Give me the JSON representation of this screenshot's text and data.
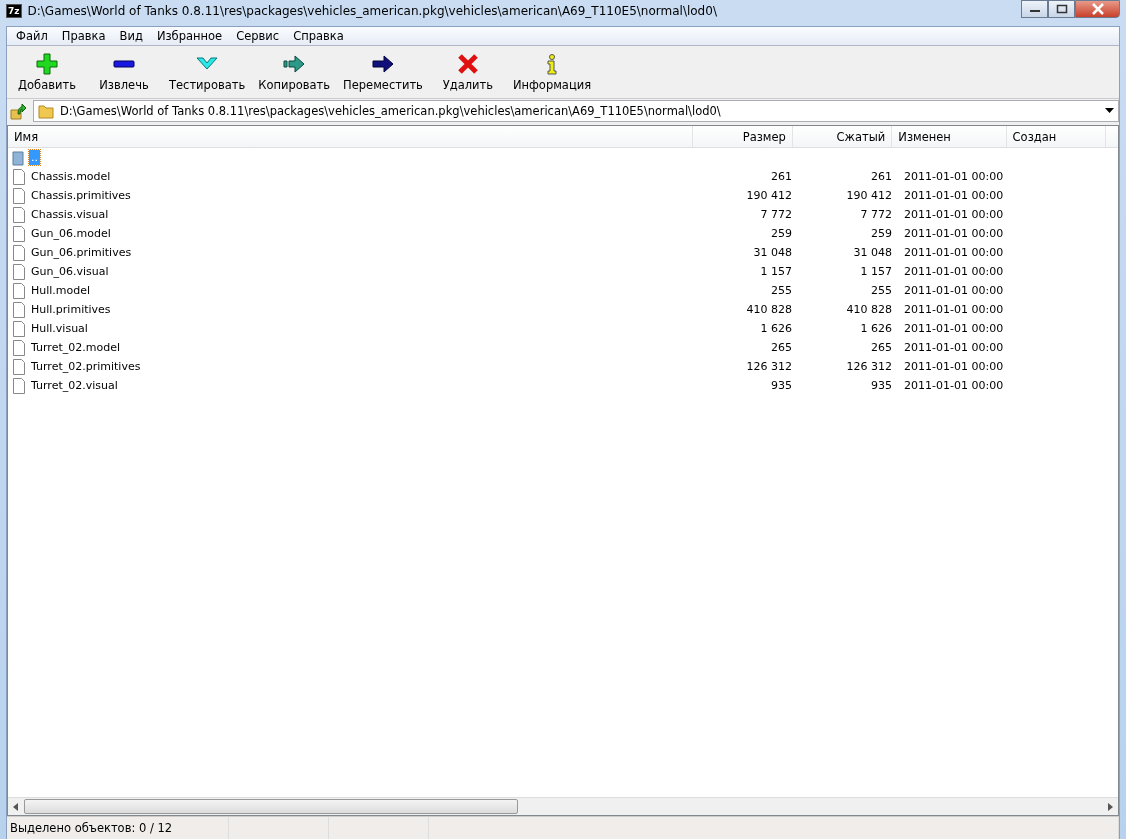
{
  "window": {
    "icon_text": "7z",
    "title": "D:\\Games\\World of Tanks 0.8.11\\res\\packages\\vehicles_american.pkg\\vehicles\\american\\A69_T110E5\\normal\\lod0\\"
  },
  "menu": [
    "Файл",
    "Правка",
    "Вид",
    "Избранное",
    "Сервис",
    "Справка"
  ],
  "toolbar": [
    {
      "kind": "add",
      "label": "Добавить"
    },
    {
      "kind": "extract",
      "label": "Извлечь"
    },
    {
      "kind": "test",
      "label": "Тестировать"
    },
    {
      "kind": "copy",
      "label": "Копировать"
    },
    {
      "kind": "move",
      "label": "Переместить"
    },
    {
      "kind": "delete",
      "label": "Удалить"
    },
    {
      "kind": "info",
      "label": "Информация"
    }
  ],
  "address": {
    "value": "D:\\Games\\World of Tanks 0.8.11\\res\\packages\\vehicles_american.pkg\\vehicles\\american\\A69_T110E5\\normal\\lod0\\"
  },
  "table": {
    "columns": [
      "Имя",
      "Размер",
      "Сжатый",
      "Изменен",
      "Создан"
    ],
    "rows": [
      {
        "kind": "parent",
        "name": "..",
        "selected": true
      },
      {
        "kind": "file",
        "name": "Chassis.model",
        "size": "261",
        "packed": "261",
        "modified": "2011-01-01 00:00",
        "selected": false
      },
      {
        "kind": "file",
        "name": "Chassis.primitives",
        "size": "190 412",
        "packed": "190 412",
        "modified": "2011-01-01 00:00",
        "selected": false
      },
      {
        "kind": "file",
        "name": "Chassis.visual",
        "size": "7 772",
        "packed": "7 772",
        "modified": "2011-01-01 00:00",
        "selected": false
      },
      {
        "kind": "file",
        "name": "Gun_06.model",
        "size": "259",
        "packed": "259",
        "modified": "2011-01-01 00:00",
        "selected": false
      },
      {
        "kind": "file",
        "name": "Gun_06.primitives",
        "size": "31 048",
        "packed": "31 048",
        "modified": "2011-01-01 00:00",
        "selected": false
      },
      {
        "kind": "file",
        "name": "Gun_06.visual",
        "size": "1 157",
        "packed": "1 157",
        "modified": "2011-01-01 00:00",
        "selected": false
      },
      {
        "kind": "file",
        "name": "Hull.model",
        "size": "255",
        "packed": "255",
        "modified": "2011-01-01 00:00",
        "selected": false
      },
      {
        "kind": "file",
        "name": "Hull.primitives",
        "size": "410 828",
        "packed": "410 828",
        "modified": "2011-01-01 00:00",
        "selected": false
      },
      {
        "kind": "file",
        "name": "Hull.visual",
        "size": "1 626",
        "packed": "1 626",
        "modified": "2011-01-01 00:00",
        "selected": false
      },
      {
        "kind": "file",
        "name": "Turret_02.model",
        "size": "265",
        "packed": "265",
        "modified": "2011-01-01 00:00",
        "selected": false
      },
      {
        "kind": "file",
        "name": "Turret_02.primitives",
        "size": "126 312",
        "packed": "126 312",
        "modified": "2011-01-01 00:00",
        "selected": false
      },
      {
        "kind": "file",
        "name": "Turret_02.visual",
        "size": "935",
        "packed": "935",
        "modified": "2011-01-01 00:00",
        "selected": false
      }
    ]
  },
  "status_bar": {
    "text": "Выделено объектов: 0 / 12"
  }
}
